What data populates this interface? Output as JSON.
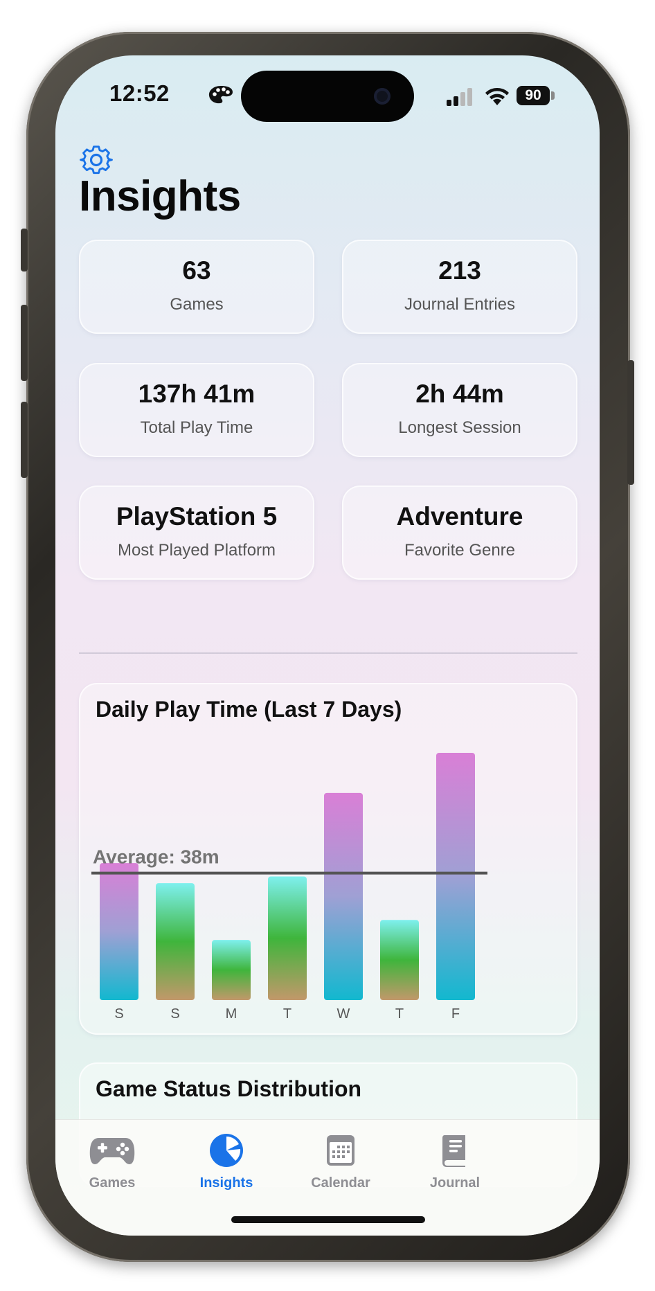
{
  "status_bar": {
    "time": "12:52",
    "battery": "90"
  },
  "header": {
    "title": "Insights"
  },
  "stats": [
    {
      "value": "63",
      "label": "Games"
    },
    {
      "value": "213",
      "label": "Journal Entries"
    },
    {
      "value": "137h 41m",
      "label": "Total Play Time"
    },
    {
      "value": "2h 44m",
      "label": "Longest Session"
    },
    {
      "value": "PlayStation 5",
      "label": "Most Played Platform"
    },
    {
      "value": "Adventure",
      "label": "Favorite Genre"
    }
  ],
  "chart_data": {
    "type": "bar",
    "title": "Daily Play Time (Last 7 Days)",
    "categories": [
      "S",
      "S",
      "M",
      "T",
      "W",
      "T",
      "F"
    ],
    "values": [
      41,
      35,
      18,
      37,
      62,
      24,
      74
    ],
    "unit": "minutes",
    "average": {
      "label": "Average: 38m",
      "value": 38
    },
    "ylim": [
      0,
      80
    ],
    "colors": {
      "above_average_top": "#d97fd6",
      "above_average_bottom": "#12b8cf",
      "below_average_top": "#7ef0ee",
      "below_average_mid": "#3fb53c",
      "below_average_bottom": "#c2986a",
      "average_line": "#555555"
    }
  },
  "status_section": {
    "title": "Game Status Distribution"
  },
  "tabs": [
    {
      "label": "Games",
      "icon": "gamepad-icon",
      "active": false
    },
    {
      "label": "Insights",
      "icon": "pie-chart-icon",
      "active": true
    },
    {
      "label": "Calendar",
      "icon": "calendar-icon",
      "active": false
    },
    {
      "label": "Journal",
      "icon": "book-icon",
      "active": false
    }
  ],
  "colors": {
    "accent": "#1a73e8",
    "inactive": "#8e8e93"
  }
}
